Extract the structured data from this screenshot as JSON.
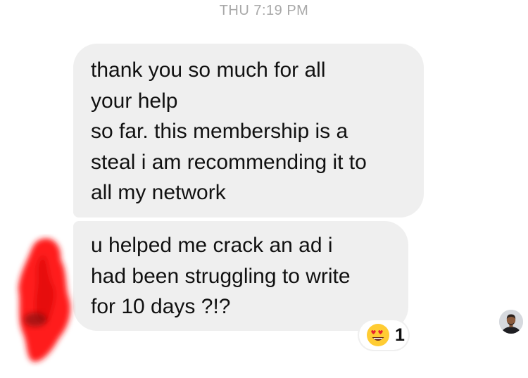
{
  "conversation": {
    "timestamp": "THU 7:19 PM",
    "messages": [
      {
        "lines": [
          "thank you so much for all",
          "your help",
          "so far. this membership is a",
          "steal i am recommending it to",
          "all my network"
        ]
      },
      {
        "lines": [
          "u helped me crack an ad i",
          "had been struggling to write",
          "for 10 days ?!?"
        ],
        "reaction": {
          "emoji": "heart-eyes-emoji",
          "count": "1"
        }
      }
    ]
  },
  "colors": {
    "incoming_bubble": "#efefef",
    "timestamp_text": "#a8a8a8",
    "redaction": "#ff1a1a"
  }
}
